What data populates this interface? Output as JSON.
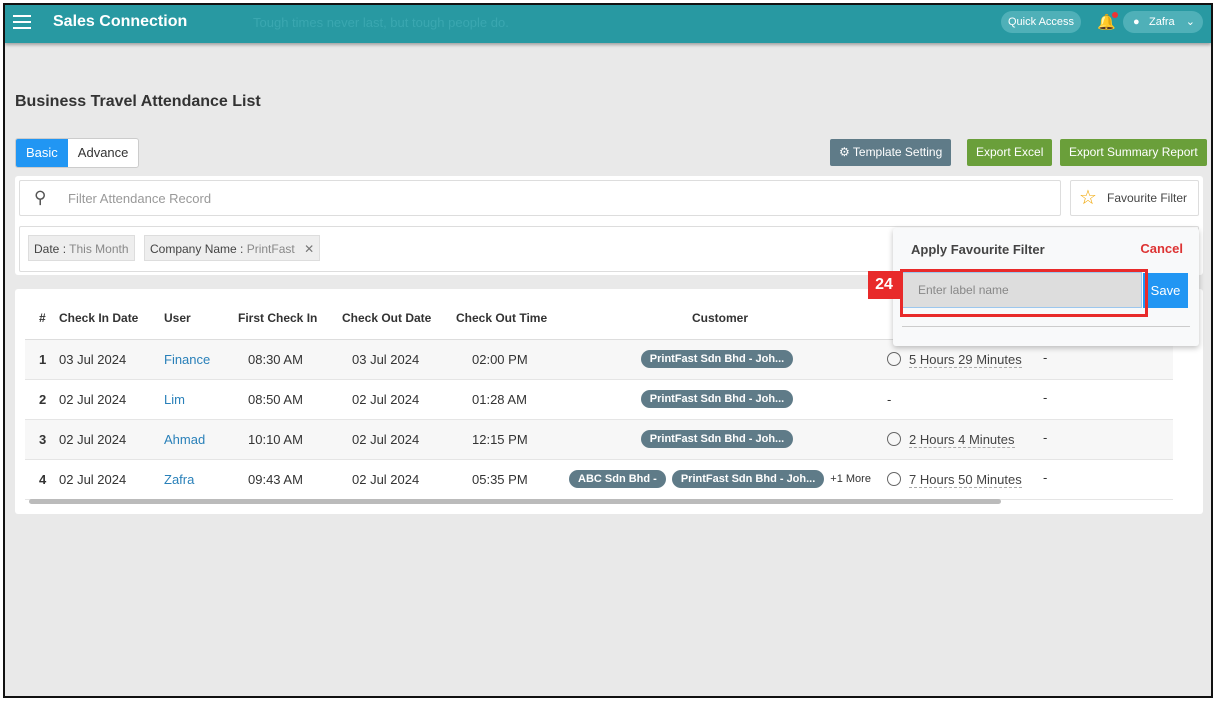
{
  "header": {
    "brand": "Sales Connection",
    "motto": "Tough times never last, but tough people do.",
    "quick_access": "Quick Access",
    "user": "Zafra"
  },
  "page": {
    "title": "Business Travel Attendance List"
  },
  "tabs": [
    "Basic",
    "Advance"
  ],
  "toolbar": {
    "template": "Template Setting",
    "export_excel": "Export Excel",
    "export_summary": "Export Summary Report"
  },
  "search": {
    "placeholder": "Filter Attendance Record",
    "favourite": "Favourite Filter"
  },
  "chips": [
    {
      "label": "Date",
      "value": "This Month"
    },
    {
      "label": "Company Name",
      "value": "PrintFast"
    }
  ],
  "table": {
    "headers": [
      "#",
      "Check In Date",
      "User",
      "First Check In",
      "Check Out Date",
      "Check Out Time",
      "Customer"
    ],
    "rows": [
      {
        "n": "1",
        "in_date": "03 Jul 2024",
        "user": "Finance",
        "first_in": "08:30 AM",
        "out_date": "03 Jul 2024",
        "out_time": "02:00 PM",
        "customers": [
          "PrintFast Sdn Bhd - Joh..."
        ],
        "more": "",
        "duration": "5 Hours 29 Minutes",
        "extra": "-"
      },
      {
        "n": "2",
        "in_date": "02 Jul 2024",
        "user": "Lim",
        "first_in": "08:50 AM",
        "out_date": "02 Jul 2024",
        "out_time": "01:28 AM",
        "customers": [
          "PrintFast Sdn Bhd - Joh..."
        ],
        "more": "",
        "duration": "-",
        "extra": "-"
      },
      {
        "n": "3",
        "in_date": "02 Jul 2024",
        "user": "Ahmad",
        "first_in": "10:10 AM",
        "out_date": "02 Jul 2024",
        "out_time": "12:15 PM",
        "customers": [
          "PrintFast Sdn Bhd - Joh..."
        ],
        "more": "",
        "duration": "2 Hours 4 Minutes",
        "extra": "-"
      },
      {
        "n": "4",
        "in_date": "02 Jul 2024",
        "user": "Zafra",
        "first_in": "09:43 AM",
        "out_date": "02 Jul 2024",
        "out_time": "05:35 PM",
        "customers": [
          "ABC Sdn Bhd -",
          "PrintFast Sdn Bhd - Joh..."
        ],
        "more": "+1 More",
        "duration": "7 Hours 50 Minutes",
        "extra": "-"
      }
    ]
  },
  "popup": {
    "title": "Apply Favourite Filter",
    "cancel": "Cancel",
    "placeholder": "Enter label name",
    "save": "Save"
  },
  "annotation": {
    "badge": "24"
  }
}
